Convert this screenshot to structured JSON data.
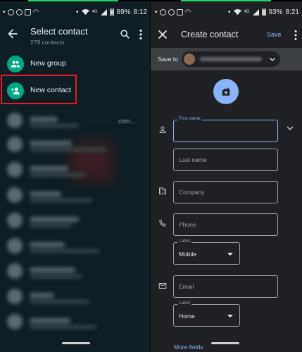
{
  "left": {
    "status": {
      "time": "8:12",
      "battery": "89%",
      "network": "4G"
    },
    "header": {
      "title": "Select contact",
      "subtitle": "279 contacts"
    },
    "rows": [
      {
        "label": "New group",
        "icon": "group-icon"
      },
      {
        "label": "New contact",
        "icon": "add-person-icon"
      }
    ],
    "ellipsis": "com...",
    "colors": {
      "accent": "#00a884",
      "highlight": "#e01b24",
      "background": "#0f1d24"
    }
  },
  "right": {
    "status": {
      "time": "8:21",
      "battery": "93%",
      "network": "4G"
    },
    "header": {
      "title": "Create contact",
      "save_label": "Save"
    },
    "save_to_label": "Save to",
    "fields": {
      "first_name": "First name",
      "last_name": "Last name",
      "company": "Company",
      "phone": "Phone",
      "phone_label": {
        "caption": "Label",
        "value": "Mobile"
      },
      "email": "Email",
      "email_label": {
        "caption": "Label",
        "value": "Home"
      }
    },
    "more_fields": "More fields",
    "colors": {
      "accent": "#8ab4f8",
      "background": "#202124"
    }
  }
}
